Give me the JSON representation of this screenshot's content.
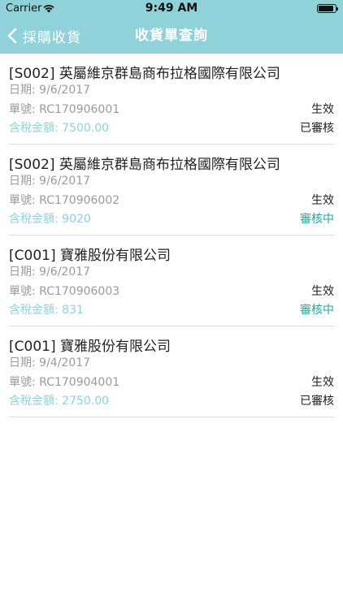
{
  "status_bar": {
    "carrier": "Carrier",
    "time": "9:49 AM"
  },
  "nav": {
    "back_label": "採購收貨",
    "title": "收貨單查詢"
  },
  "colors": {
    "accent": "#8fd2d9",
    "pending": "#2ea69b"
  },
  "labels": {
    "date": "日期:",
    "number": "單號:",
    "amount": "含稅金額:"
  },
  "receipts": [
    {
      "supplier": "[S002] 英屬維京群島商布拉格國際有限公司",
      "date": "9/6/2017",
      "number": "RC170906001",
      "state": "生效",
      "amount": "7500.00",
      "review": "已審核",
      "review_type": "approved"
    },
    {
      "supplier": "[S002] 英屬維京群島商布拉格國際有限公司",
      "date": "9/6/2017",
      "number": "RC170906002",
      "state": "生效",
      "amount": "9020",
      "review": "審核中",
      "review_type": "pending"
    },
    {
      "supplier": "[C001] 寶雅股份有限公司",
      "date": "9/6/2017",
      "number": "RC170906003",
      "state": "生效",
      "amount": "831",
      "review": "審核中",
      "review_type": "pending"
    },
    {
      "supplier": "[C001] 寶雅股份有限公司",
      "date": "9/4/2017",
      "number": "RC170904001",
      "state": "生效",
      "amount": "2750.00",
      "review": "已審核",
      "review_type": "approved"
    }
  ]
}
